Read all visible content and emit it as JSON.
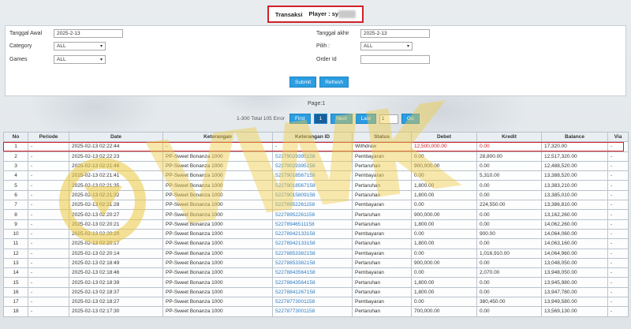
{
  "header": {
    "label": "Transaksi",
    "player_prefix": "Player : sy"
  },
  "filters": {
    "tanggal_awal_label": "Tanggal Awal",
    "tanggal_awal_value": "2025-2-13",
    "category_label": "Category",
    "category_value": "ALL",
    "games_label": "Games",
    "games_value": "ALL",
    "tanggal_akhir_label": "Tanggal akhir",
    "tanggal_akhir_value": "2025-2-13",
    "pilih_label": "Pilih :",
    "pilih_value": "ALL",
    "order_id_label": "Order Id",
    "order_id_value": "",
    "submit_label": "Submit",
    "refresh_label": "Refresh"
  },
  "pager": {
    "page_label": "Page:1",
    "total_text": "1-300 Total 105 Error",
    "first": "First",
    "current": "1",
    "next": "Next",
    "last": "Last",
    "page_input": "1",
    "go": "Go"
  },
  "table": {
    "headers": [
      "No",
      "Periode",
      "Date",
      "Keterangan",
      "Keterangan ID",
      "Status",
      "Debet",
      "Kredit",
      "Balance",
      "Via"
    ],
    "rows": [
      [
        "1",
        "-",
        "2025-02-13 02:22:44",
        "-",
        "-",
        "Withdraw",
        "12,500,000.00",
        "0.00",
        "17,320.00",
        "-"
      ],
      [
        "2",
        "-",
        "2025-02-13 02:22:23",
        "PP-Sweet Bonanza 1000",
        "52279029395158",
        "Pembayaran",
        "0.00",
        "28,800.00",
        "12,517,320.00",
        "-"
      ],
      [
        "3",
        "-",
        "2025-02-13 02:21:46",
        "PP-Sweet Bonanza 1000",
        "52279029395158",
        "Pertaruhan",
        "900,000.00",
        "0.00",
        "12,488,520.00",
        "-"
      ],
      [
        "4",
        "-",
        "2025-02-13 02:21:41",
        "PP-Sweet Bonanza 1000",
        "52279018567158",
        "Pembayaran",
        "0.00",
        "5,310.00",
        "13,388,520.00",
        "-"
      ],
      [
        "5",
        "-",
        "2025-02-13 02:21:35",
        "PP-Sweet Bonanza 1000",
        "52279018567158",
        "Pertaruhan",
        "1,800.00",
        "0.00",
        "13,383,210.00",
        "-"
      ],
      [
        "6",
        "-",
        "2025-02-13 02:21:32",
        "PP-Sweet Bonanza 1000",
        "52279015809158",
        "Pertaruhan",
        "1,800.00",
        "0.00",
        "13,385,010.00",
        "-"
      ],
      [
        "7",
        "-",
        "2025-02-13 02:21:28",
        "PP-Sweet Bonanza 1000",
        "52278952261158",
        "Pembayaran",
        "0.00",
        "224,550.00",
        "13,386,810.00",
        "-"
      ],
      [
        "8",
        "-",
        "2025-02-13 02:20:27",
        "PP-Sweet Bonanza 1000",
        "52278952261158",
        "Pertaruhan",
        "900,000.00",
        "0.00",
        "13,162,260.00",
        "-"
      ],
      [
        "9",
        "-",
        "2025-02-13 02:20:21",
        "PP-Sweet Bonanza 1000",
        "52278946511158",
        "Pertaruhan",
        "1,800.00",
        "0.00",
        "14,062,260.00",
        "-"
      ],
      [
        "10",
        "-",
        "2025-02-13 02:20:20",
        "PP-Sweet Bonanza 1000",
        "52278942133158",
        "Pembayaran",
        "0.00",
        "900.00",
        "14,064,060.00",
        "-"
      ],
      [
        "11",
        "-",
        "2025-02-13 02:20:17",
        "PP-Sweet Bonanza 1000",
        "52278942133158",
        "Pertaruhan",
        "1,800.00",
        "0.00",
        "14,063,160.00",
        "-"
      ],
      [
        "12",
        "-",
        "2025-02-13 02:20:14",
        "PP-Sweet Bonanza 1000",
        "52278853382158",
        "Pembayaran",
        "0.00",
        "1,016,910.00",
        "14,064,960.00",
        "-"
      ],
      [
        "13",
        "-",
        "2025-02-13 02:18:49",
        "PP-Sweet Bonanza 1000",
        "52278853382158",
        "Pertaruhan",
        "900,000.00",
        "0.00",
        "13,048,050.00",
        "-"
      ],
      [
        "14",
        "-",
        "2025-02-13 02:18:46",
        "PP-Sweet Bonanza 1000",
        "52278843564158",
        "Pembayaran",
        "0.00",
        "2,070.00",
        "13,948,050.00",
        "-"
      ],
      [
        "15",
        "-",
        "2025-02-13 02:18:39",
        "PP-Sweet Bonanza 1000",
        "52278843564158",
        "Pertaruhan",
        "1,800.00",
        "0.00",
        "13,945,980.00",
        "-"
      ],
      [
        "16",
        "-",
        "2025-02-13 02:18:37",
        "PP-Sweet Bonanza 1000",
        "52278841267158",
        "Pertaruhan",
        "1,800.00",
        "0.00",
        "13,947,780.00",
        "-"
      ],
      [
        "17",
        "-",
        "2025-02-13 02:18:27",
        "PP-Sweet Bonanza 1000",
        "52278773001158",
        "Pembayaran",
        "0.00",
        "380,450.00",
        "13,949,580.00",
        "-"
      ],
      [
        "18",
        "-",
        "2025-02-13 02:17:30",
        "PP-Sweet Bonanza 1000",
        "52278773001158",
        "Pertaruhan",
        "700,000.00",
        "0.00",
        "13,569,130.00",
        "-"
      ]
    ]
  },
  "watermark_text": "VWK",
  "colors": {
    "accent": "#2b9de0",
    "highlight": "#d0212a",
    "link": "#2b7bc0"
  }
}
